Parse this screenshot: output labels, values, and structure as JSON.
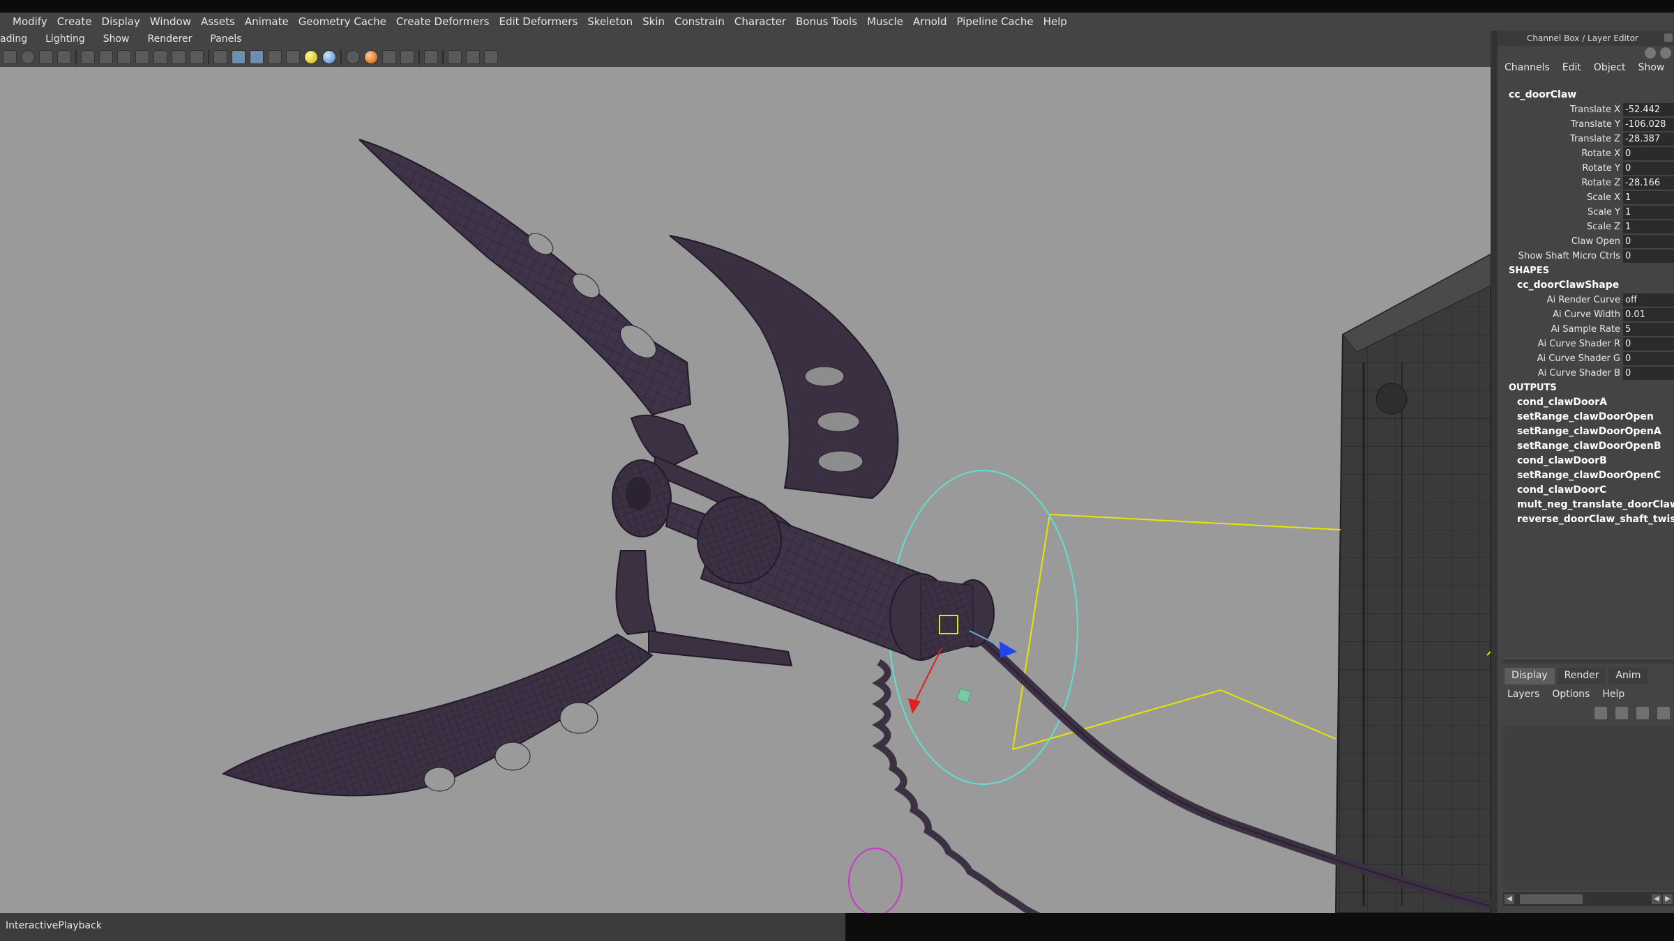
{
  "menubar": {
    "items": [
      "Modify",
      "Create",
      "Display",
      "Window",
      "Assets",
      "Animate",
      "Geometry Cache",
      "Create Deformers",
      "Edit Deformers",
      "Skeleton",
      "Skin",
      "Constrain",
      "Character",
      "Bonus Tools",
      "Muscle",
      "Arnold",
      "Pipeline Cache",
      "Help"
    ]
  },
  "panel_menu": {
    "items": [
      "ading",
      "Lighting",
      "Show",
      "Renderer",
      "Panels"
    ]
  },
  "toolbar": {
    "icons": [
      "key-icon",
      "refresh-icon",
      "pen-icon",
      "magnet-icon",
      "grid-icon",
      "film-gate-icon",
      "resolution-gate-icon",
      "safe-area-icon",
      "field-chart-icon",
      "xray-icon",
      "isolate-icon",
      "wireframe-icon",
      "smooth-shade-icon",
      "shaded-wire-icon",
      "texture-icon",
      "light-icon",
      "shadow-icon",
      "ambient-occlusion-icon",
      "motion-blur-icon",
      "antialias-icon",
      "camera-icon",
      "bounding-box-icon",
      "frame-icon",
      "share-icon"
    ]
  },
  "channel_box": {
    "title": "Channel Box / Layer Editor",
    "menu": [
      "Channels",
      "Edit",
      "Object",
      "Show"
    ],
    "node": "cc_doorClaw",
    "attributes": [
      {
        "label": "Translate X",
        "value": "-52.442"
      },
      {
        "label": "Translate Y",
        "value": "-106.028"
      },
      {
        "label": "Translate Z",
        "value": "-28.387"
      },
      {
        "label": "Rotate X",
        "value": "0"
      },
      {
        "label": "Rotate Y",
        "value": "0"
      },
      {
        "label": "Rotate Z",
        "value": "-28.166"
      },
      {
        "label": "Scale X",
        "value": "1"
      },
      {
        "label": "Scale Y",
        "value": "1"
      },
      {
        "label": "Scale Z",
        "value": "1"
      },
      {
        "label": "Claw Open",
        "value": "0"
      },
      {
        "label": "Show Shaft Micro Ctrls",
        "value": "0"
      }
    ],
    "shapes_header": "SHAPES",
    "shape_node": "cc_doorClawShape",
    "shape_attributes": [
      {
        "label": "Ai Render Curve",
        "value": "off"
      },
      {
        "label": "Ai Curve Width",
        "value": "0.01"
      },
      {
        "label": "Ai Sample Rate",
        "value": "5"
      },
      {
        "label": "Ai Curve Shader R",
        "value": "0"
      },
      {
        "label": "Ai Curve Shader G",
        "value": "0"
      },
      {
        "label": "Ai Curve Shader B",
        "value": "0"
      }
    ],
    "outputs_header": "OUTPUTS",
    "outputs": [
      "cond_clawDoorA",
      "setRange_clawDoorOpen",
      "setRange_clawDoorOpenA",
      "setRange_clawDoorOpenB",
      "cond_clawDoorB",
      "setRange_clawDoorOpenC",
      "cond_clawDoorC",
      "mult_neg_translate_doorClaw",
      "reverse_doorClaw_shaft_twist"
    ]
  },
  "layer_editor": {
    "tabs": [
      "Display",
      "Render",
      "Anim"
    ],
    "active_tab": "Display",
    "menu": [
      "Layers",
      "Options",
      "Help"
    ]
  },
  "help_line": {
    "text": "InteractivePlayback"
  },
  "colors": {
    "viewport_bg": "#9a9a9a",
    "wire_mesh": "#3f3447",
    "wire_lines": "#2a1f36",
    "selection_yellow": "#e6e600",
    "control_cyan": "#5fe0d0",
    "ui_panel": "#444444"
  }
}
